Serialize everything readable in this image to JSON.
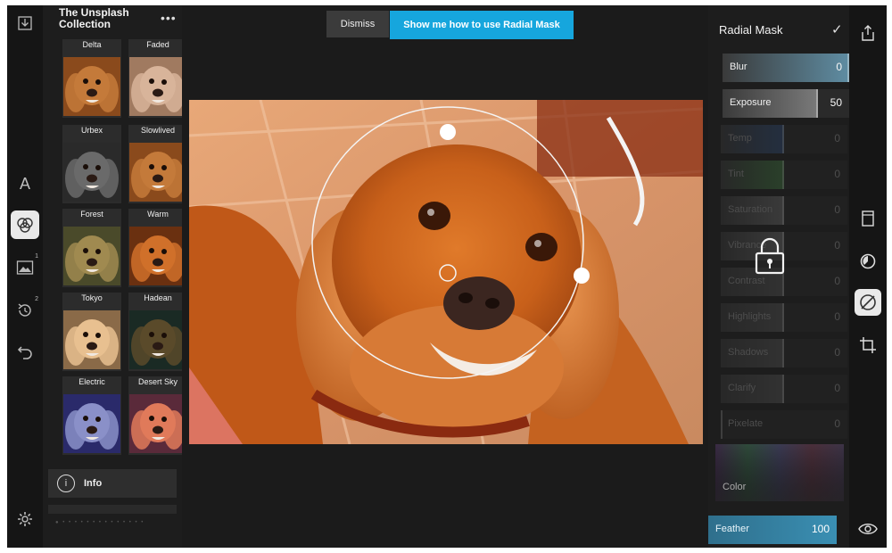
{
  "app": {
    "colors": {
      "accent": "#16a6dd",
      "background": "#1b1b1b",
      "panel": "#1d1d1d",
      "feather": "#3a8fb3"
    }
  },
  "left_toolbar": {
    "tools": [
      {
        "id": "text",
        "icon": "text-icon",
        "label": "A"
      },
      {
        "id": "filters",
        "icon": "filters-icon",
        "active": true
      },
      {
        "id": "overlay",
        "icon": "image-icon",
        "badge": "1"
      },
      {
        "id": "history",
        "icon": "history-icon",
        "badge": "2"
      },
      {
        "id": "undo",
        "icon": "undo-icon"
      },
      {
        "id": "settings",
        "icon": "gear-icon"
      }
    ]
  },
  "collection": {
    "title": "The Unsplash Collection",
    "more": "•••",
    "filters": [
      {
        "name": "Delta",
        "style": "warm"
      },
      {
        "name": "Faded",
        "style": "faded"
      },
      {
        "name": "Urbex",
        "style": "urbex"
      },
      {
        "name": "Slowlived",
        "style": "warm"
      },
      {
        "name": "Forest",
        "style": "forest"
      },
      {
        "name": "Warm",
        "style": "warmstrong"
      },
      {
        "name": "Tokyo",
        "style": "tokyo"
      },
      {
        "name": "Hadean",
        "style": "hadean"
      },
      {
        "name": "Electric",
        "style": "electric"
      },
      {
        "name": "Desert Sky",
        "style": "desertsky"
      }
    ],
    "info_label": "Info",
    "info_glyph": "i"
  },
  "banner": {
    "dismiss": "Dismiss",
    "show_me": "Show me how to use Radial Mask"
  },
  "adjust": {
    "title": "Radial Mask",
    "confirm_glyph": "✓",
    "sliders": [
      {
        "label": "Blur",
        "value": "0",
        "level": 1.0,
        "color": "#5f8da3",
        "locked": false
      },
      {
        "label": "Exposure",
        "value": "50",
        "level": 0.75,
        "color": "#7a7a7a",
        "locked": false
      },
      {
        "label": "Temp",
        "value": "0",
        "level": 0.5,
        "color": "#2f4d7a",
        "locked": true
      },
      {
        "label": "Tint",
        "value": "0",
        "level": 0.5,
        "color": "#3f7a3f",
        "locked": true
      },
      {
        "label": "Saturation",
        "value": "0",
        "level": 0.5,
        "color": "#6b6b6b",
        "locked": true
      },
      {
        "label": "Vibrance",
        "value": "0",
        "level": 0.5,
        "color": "#6b6b6b",
        "locked": true
      },
      {
        "label": "Contrast",
        "value": "0",
        "level": 0.5,
        "color": "#555555",
        "locked": true
      },
      {
        "label": "Highlights",
        "value": "0",
        "level": 0.5,
        "color": "#555555",
        "locked": true
      },
      {
        "label": "Shadows",
        "value": "0",
        "level": 0.5,
        "color": "#555555",
        "locked": true
      },
      {
        "label": "Clarify",
        "value": "0",
        "level": 0.5,
        "color": "#555555",
        "locked": true
      },
      {
        "label": "Pixelate",
        "value": "0",
        "level": 0.0,
        "color": "#555555",
        "locked": true
      }
    ],
    "color_label": "Color",
    "feather": {
      "label": "Feather",
      "value": "100",
      "level": 1.0,
      "color": "#3a8fb3"
    }
  },
  "right_toolbar": {
    "tools": [
      {
        "id": "share",
        "icon": "share-icon"
      },
      {
        "id": "frame",
        "icon": "frame-icon"
      },
      {
        "id": "radial",
        "icon": "radial-mask-icon"
      },
      {
        "id": "mask",
        "icon": "mask-icon",
        "active": true
      },
      {
        "id": "crop",
        "icon": "crop-icon"
      },
      {
        "id": "preview",
        "icon": "eye-icon"
      }
    ]
  }
}
